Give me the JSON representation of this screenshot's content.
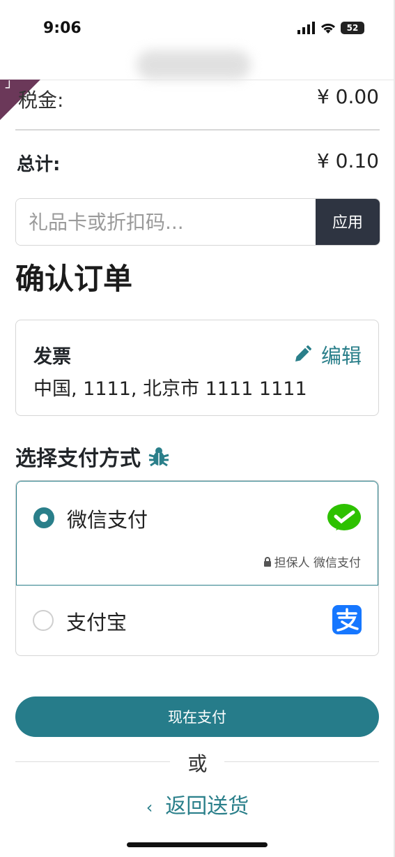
{
  "status_bar": {
    "time": "9:06",
    "battery": "52"
  },
  "summary": {
    "tax_label": "税金:",
    "tax_value": "¥ 0.00",
    "total_label": "总计:",
    "total_value": "¥ 0.10"
  },
  "promo": {
    "placeholder": "礼品卡或折扣码...",
    "apply_label": "应用"
  },
  "page_title": "确认订单",
  "invoice": {
    "title": "发票",
    "edit_label": "编辑",
    "address": "中国, 1111, 北京市 1111 1111"
  },
  "payment": {
    "title": "选择支付方式",
    "options": [
      {
        "label": "微信支付",
        "selected": true,
        "secured_note": "担保人 微信支付"
      },
      {
        "label": "支付宝",
        "selected": false
      }
    ]
  },
  "actions": {
    "pay_now": "现在支付",
    "or": "或",
    "back": "返回送货"
  },
  "colors": {
    "accent": "#2a7f8a",
    "apply_button": "#2e3441",
    "ribbon": "#6b3859",
    "wechat": "#2dc100",
    "alipay": "#1677ff"
  }
}
